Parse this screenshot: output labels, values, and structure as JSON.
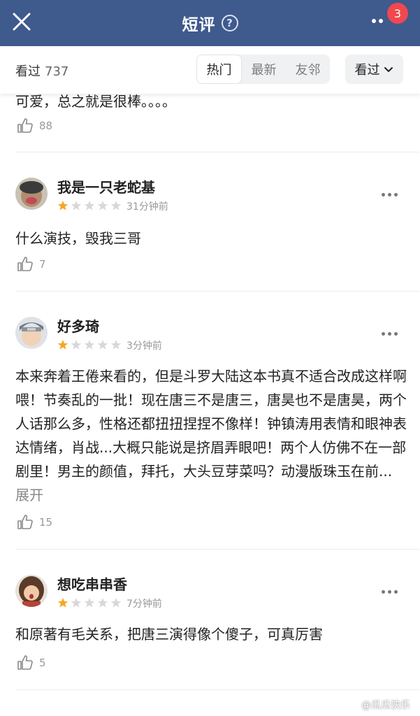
{
  "header": {
    "title": "短评",
    "help_symbol": "?",
    "badge_count": "3"
  },
  "filter": {
    "seen_label": "看过",
    "seen_count": "737",
    "tabs": [
      {
        "label": "热门",
        "active": true
      },
      {
        "label": "最新",
        "active": false
      },
      {
        "label": "友邻",
        "active": false
      }
    ],
    "dropdown_label": "看过"
  },
  "comments": [
    {
      "text": "可爱，总之就是很棒。。。。",
      "likes": "88",
      "partial": true
    },
    {
      "user": "我是一只老蛇基",
      "rating": 1,
      "time": "31分钟前",
      "text": "什么演技，毁我三哥",
      "likes": "7"
    },
    {
      "user": "好多琦",
      "rating": 1,
      "time": "3分钟前",
      "text": "本来奔着王倦来看的，但是斗罗大陆这本书真不适合改成这样啊喂！节奏乱的一批！现在唐三不是唐三，唐昊也不是唐昊，两个人话那么多，性格还都扭扭捏捏不像样！钟镇涛用表情和眼神表达情绪，肖战...大概只能说是挤眉弄眼吧！两个人仿佛不在一部剧里！男主的颜值，拜托，大头豆芽菜吗？动漫版珠玉在前...",
      "expand": "展开",
      "likes": "15"
    },
    {
      "user": "想吃串串香",
      "rating": 1,
      "time": "7分钟前",
      "text": "和原著有毛关系，把唐三演得像个傻子，可真厉害",
      "likes": "5"
    }
  ],
  "watermark": "@瓜瓜快乐",
  "colors": {
    "header_bg": "#3f5a8d",
    "badge": "#f0484f",
    "star_on": "#f5a623",
    "star_off": "#d8d8d8"
  }
}
